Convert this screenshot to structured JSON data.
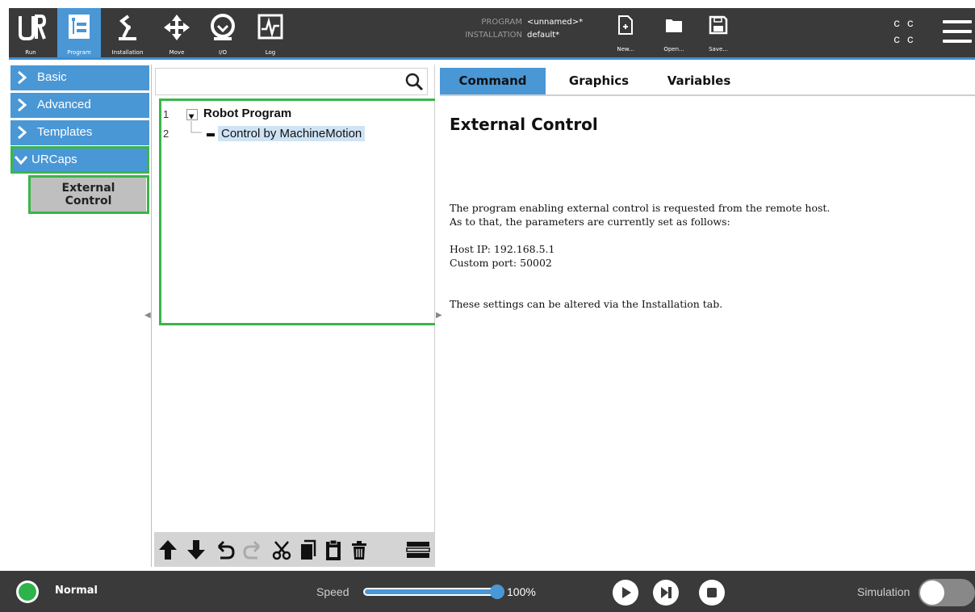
{
  "header": {
    "tabs": [
      {
        "label": "Run",
        "icon": "ur-logo-icon",
        "active": false
      },
      {
        "label": "Program",
        "icon": "program-icon",
        "active": true
      },
      {
        "label": "Installation",
        "icon": "installation-icon",
        "active": false
      },
      {
        "label": "Move",
        "icon": "move-icon",
        "active": false
      },
      {
        "label": "I/O",
        "icon": "io-icon",
        "active": false
      },
      {
        "label": "Log",
        "icon": "log-icon",
        "active": false
      }
    ],
    "program_label": "PROGRAM",
    "program_value": "<unnamed>*",
    "installation_label": "INSTALLATION",
    "installation_value": "default*",
    "file_buttons": [
      {
        "label": "New...",
        "icon": "new-file-icon"
      },
      {
        "label": "Open...",
        "icon": "open-folder-icon"
      },
      {
        "label": "Save...",
        "icon": "save-icon"
      }
    ],
    "cc_top": "c c",
    "cc_bottom": "c c",
    "menu_icon": "hamburger-menu-icon"
  },
  "sidebar": {
    "items": [
      {
        "label": "Basic",
        "expanded": false
      },
      {
        "label": "Advanced",
        "expanded": false
      },
      {
        "label": "Templates",
        "expanded": false
      },
      {
        "label": "URCaps",
        "expanded": true
      }
    ],
    "subitem": {
      "line1": "External",
      "line2": "Control"
    }
  },
  "tree": {
    "search_placeholder": "",
    "rows": [
      {
        "num": "1",
        "label": "Robot Program"
      },
      {
        "num": "2",
        "label": "Control by MachineMotion"
      }
    ]
  },
  "tabs": [
    {
      "label": "Command",
      "active": true
    },
    {
      "label": "Graphics",
      "active": false
    },
    {
      "label": "Variables",
      "active": false
    }
  ],
  "command": {
    "title": "External Control",
    "line1": "The program enabling external control is requested from the remote host.",
    "line2": "As to that, the parameters are currently set as follows:",
    "host_ip": "Host IP: 192.168.5.1",
    "custom_port": "Custom port: 50002",
    "note": "These settings can be altered via the Installation tab."
  },
  "footer": {
    "status": "Normal",
    "speed_label": "Speed",
    "speed_value": "100%",
    "speed_fraction": 1.0,
    "simulation_label": "Simulation",
    "simulation_on": false,
    "accent": "#4a97d6",
    "status_color": "#2db34a"
  }
}
